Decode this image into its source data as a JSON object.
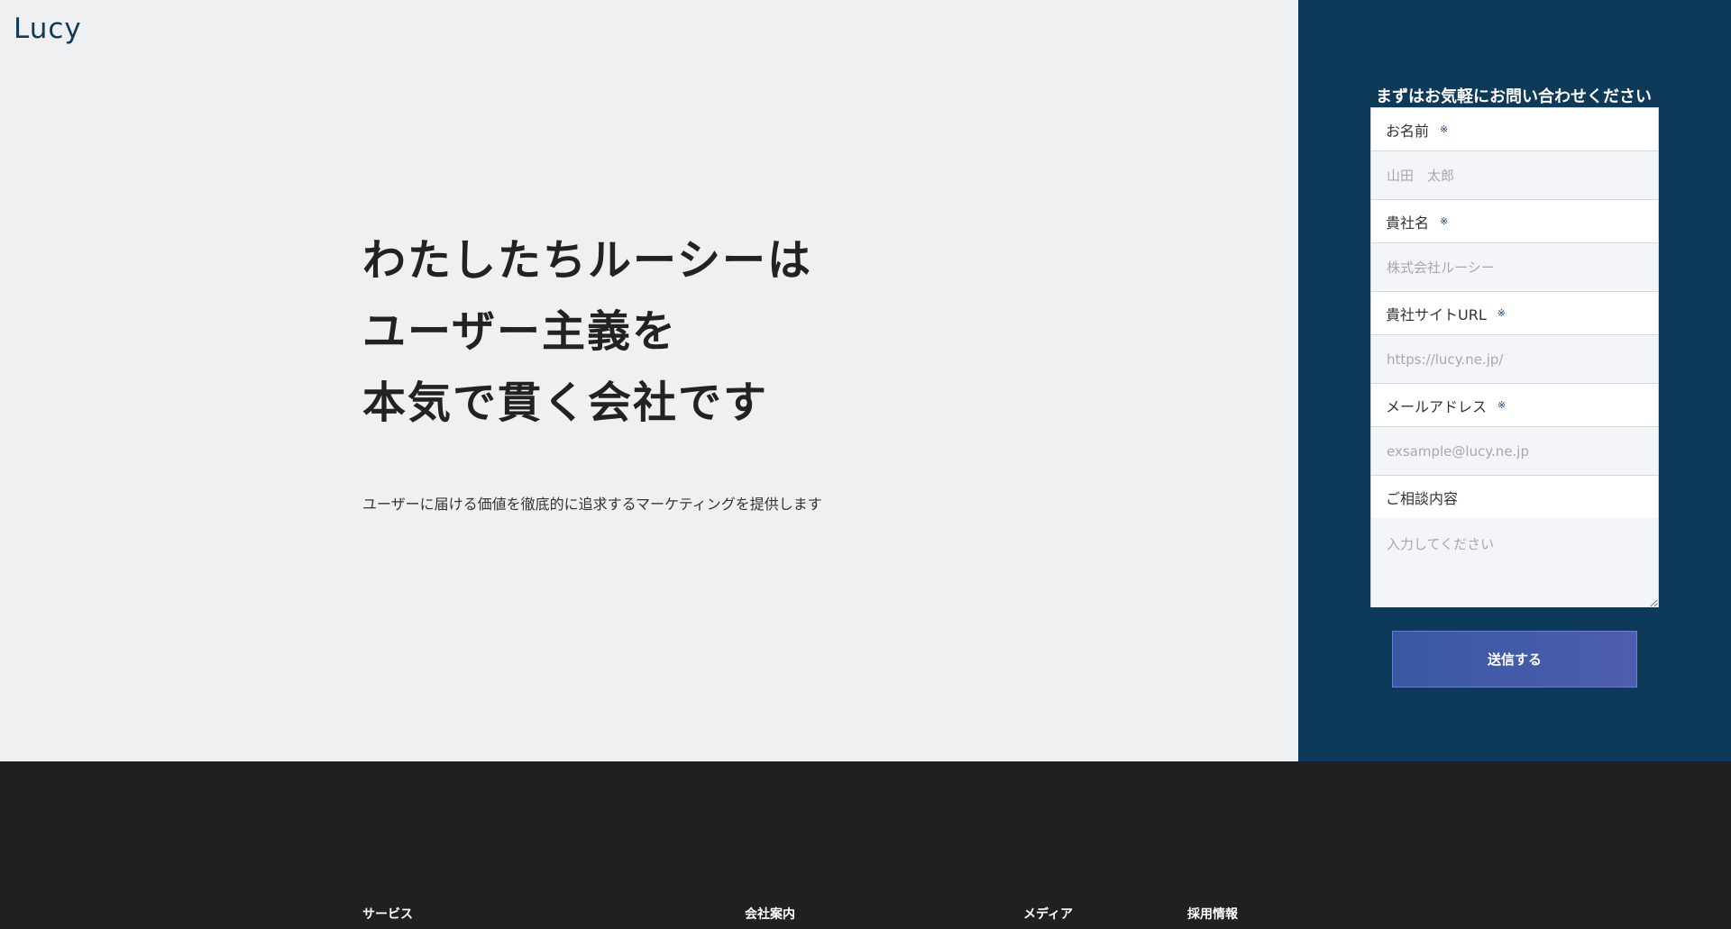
{
  "brand": {
    "logo_text": "Lucy"
  },
  "hero": {
    "headline": [
      "わたしたちルーシーは",
      "ユーザー主義を",
      "本気で貫く会社です"
    ],
    "subcopy": "ユーザーに届ける価値を徹底的に追求するマーケティングを提供します"
  },
  "form": {
    "title": "まずはお気軽にお問い合わせください",
    "required_mark": "※",
    "fields": [
      {
        "label": "お名前",
        "required": true,
        "placeholder": "山田　太郎"
      },
      {
        "label": "貴社名",
        "required": true,
        "placeholder": "株式会社ルーシー"
      },
      {
        "label": "貴社サイトURL",
        "required": true,
        "placeholder": "https://lucy.ne.jp/"
      },
      {
        "label": "メールアドレス",
        "required": true,
        "placeholder": "exsample@lucy.ne.jp"
      },
      {
        "label": "ご相談内容",
        "required": false,
        "placeholder": "入力してください"
      }
    ],
    "submit_label": "送信する"
  },
  "footer": {
    "nav": [
      "サービス",
      "会社案内",
      "メディア",
      "採用情報"
    ]
  },
  "colors": {
    "hero_bg": "#eff0f2",
    "panel_bg": "#0d3a59",
    "footer_bg": "#202020",
    "button_gradient_start": "#3758a2",
    "button_gradient_end": "#4f5dae"
  }
}
